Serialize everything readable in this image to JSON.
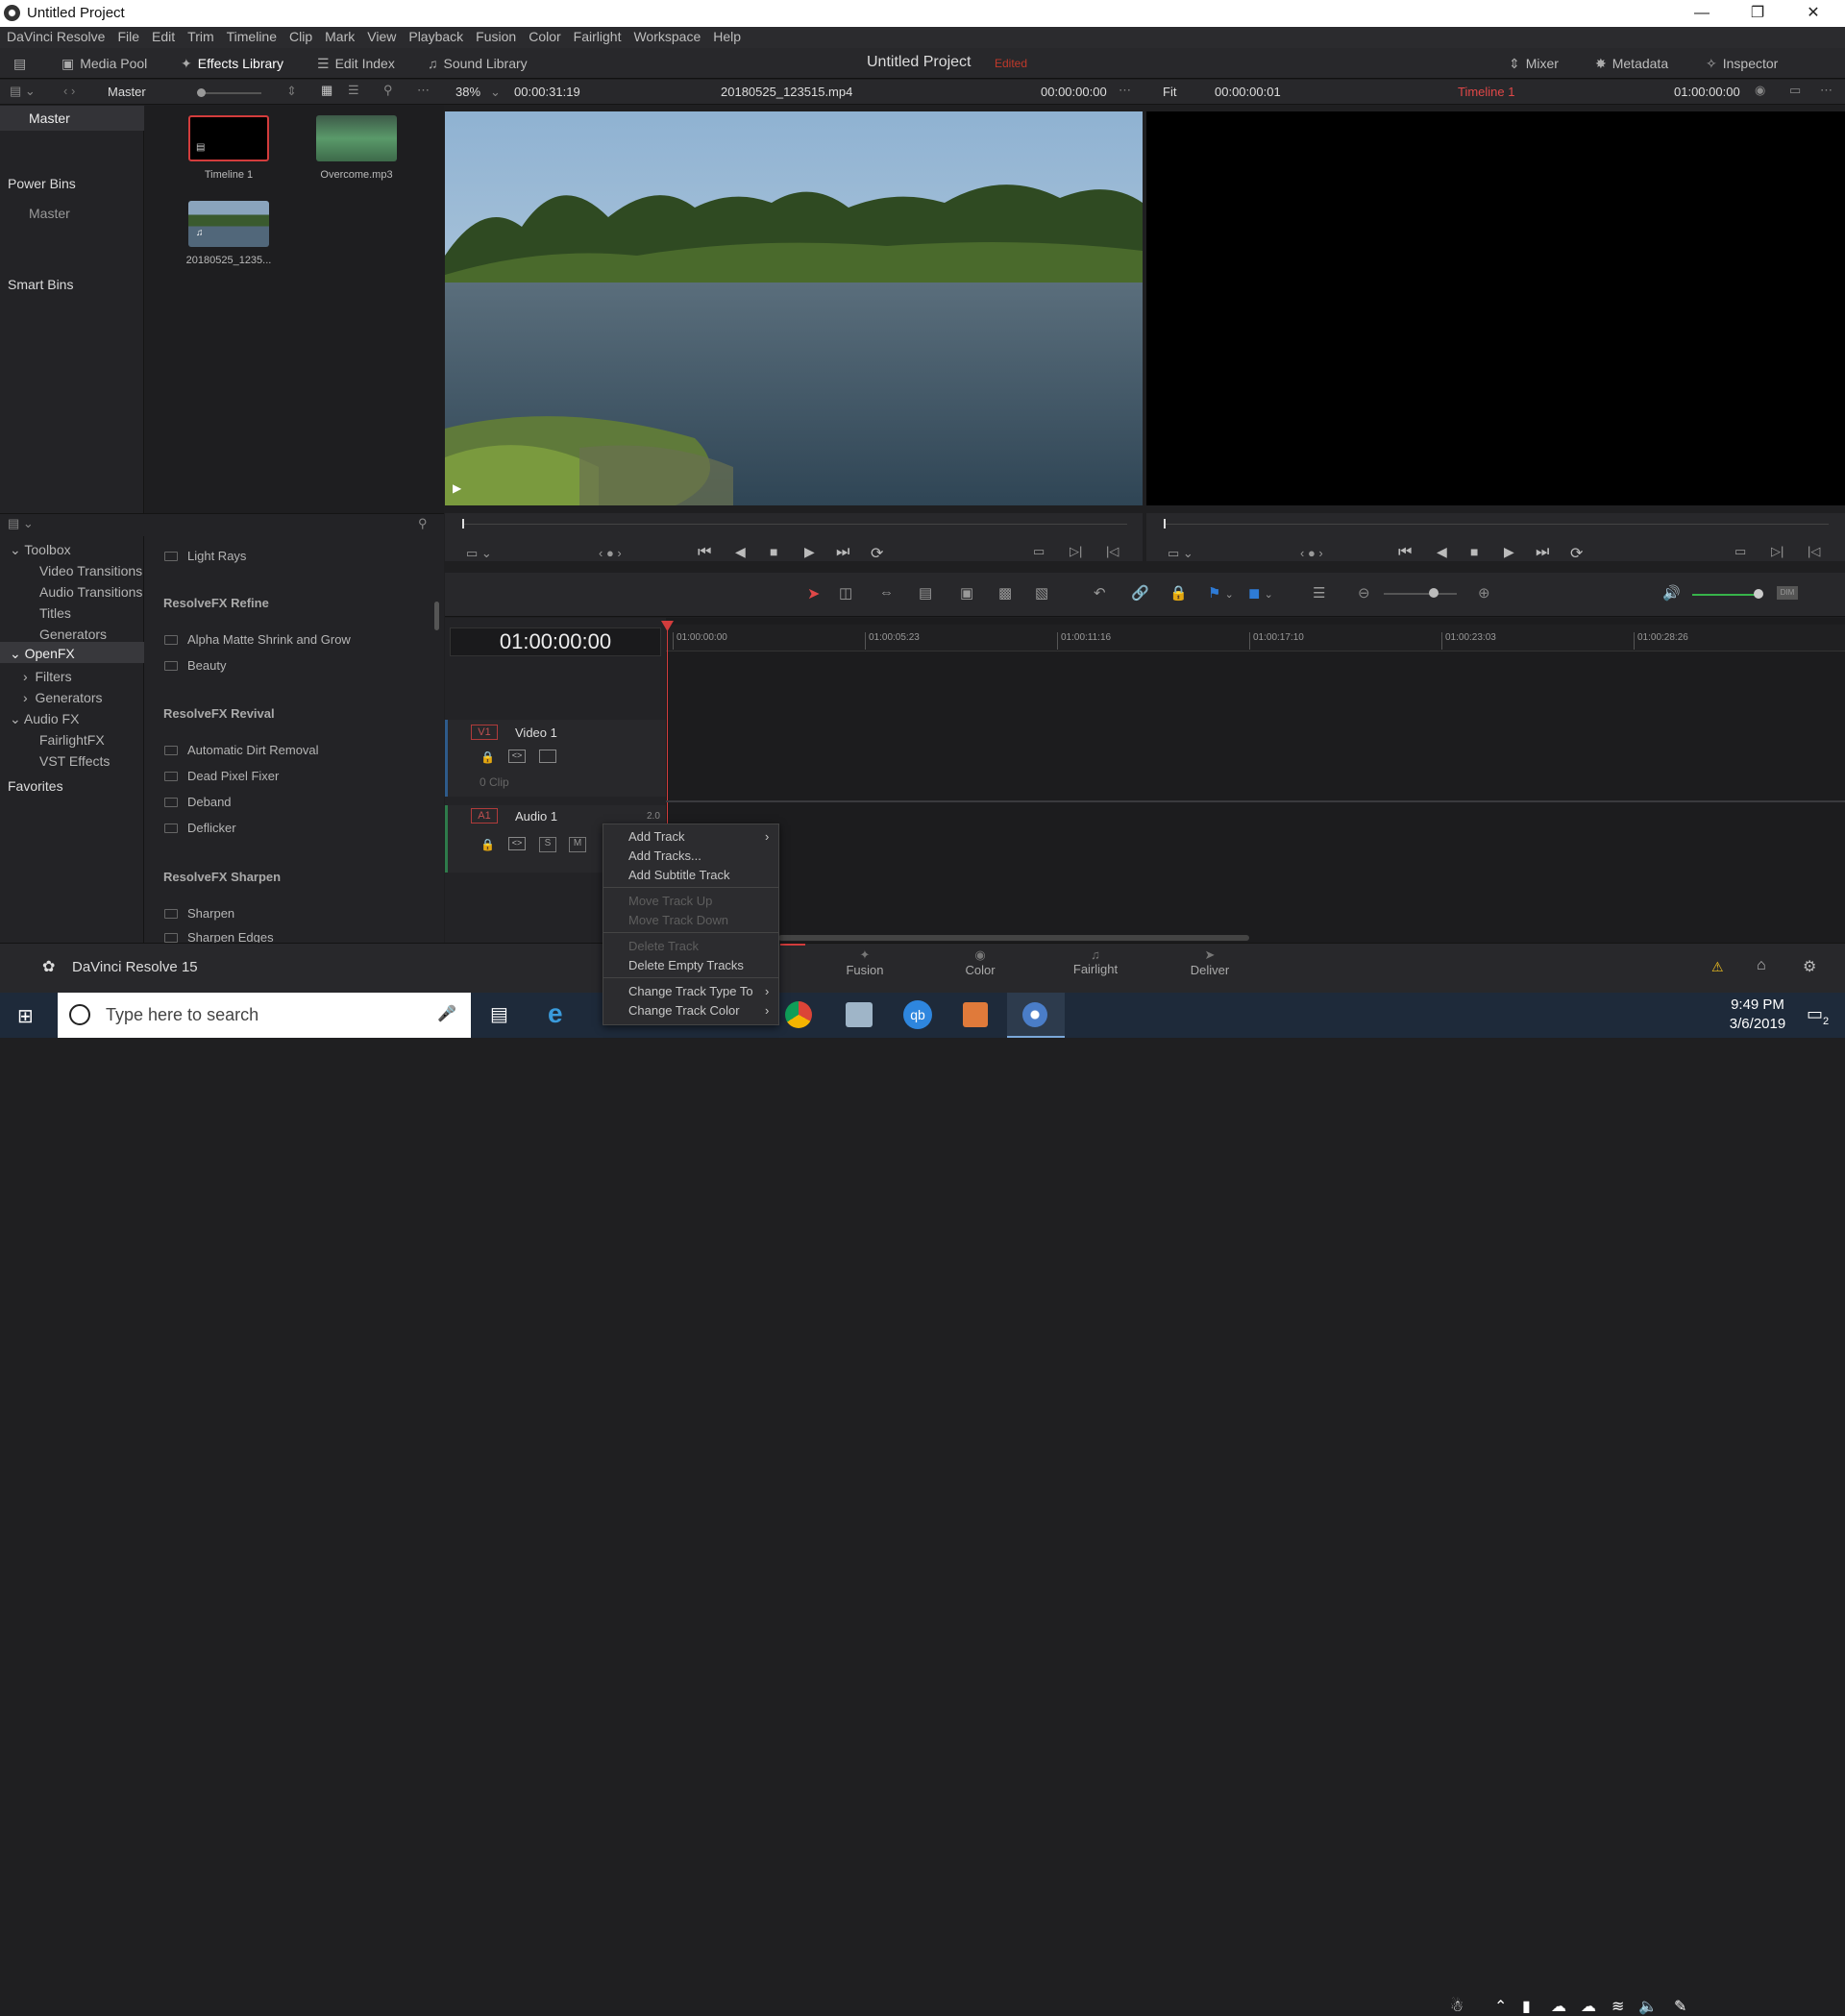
{
  "window": {
    "title": "Untitled Project"
  },
  "menu": [
    "DaVinci Resolve",
    "File",
    "Edit",
    "Trim",
    "Timeline",
    "Clip",
    "Mark",
    "View",
    "Playback",
    "Fusion",
    "Color",
    "Fairlight",
    "Workspace",
    "Help"
  ],
  "toolbar": {
    "media_pool": "Media Pool",
    "effects_library": "Effects Library",
    "edit_index": "Edit Index",
    "sound_library": "Sound Library",
    "project_title": "Untitled Project",
    "edited": "Edited",
    "mixer": "Mixer",
    "metadata": "Metadata",
    "inspector": "Inspector"
  },
  "subbar": {
    "bin": "Master",
    "zoom": "38%",
    "src_duration": "00:00:31:19",
    "clip_name": "20180525_123515.mp4",
    "src_tc": "00:00:00:00",
    "fit": "Fit",
    "prog_tc_a": "00:00:00:01",
    "timeline_name": "Timeline 1",
    "prog_tc_b": "01:00:00:00"
  },
  "bins": {
    "master": "Master",
    "power_bins": "Power Bins",
    "power_master": "Master",
    "smart_bins": "Smart Bins"
  },
  "clips": [
    {
      "name": "Timeline 1"
    },
    {
      "name": "Overcome.mp3"
    },
    {
      "name": "20180525_1235..."
    }
  ],
  "effects_tree": {
    "toolbox": "Toolbox",
    "video_transitions": "Video Transitions",
    "audio_transitions": "Audio Transitions",
    "titles": "Titles",
    "generators": "Generators",
    "openfx": "OpenFX",
    "filters": "Filters",
    "generators2": "Generators",
    "audio_fx": "Audio FX",
    "fairlightfx": "FairlightFX",
    "vst": "VST Effects",
    "favorites": "Favorites"
  },
  "fx": {
    "light_rays": "Light Rays",
    "refine": "ResolveFX Refine",
    "alpha": "Alpha Matte Shrink and Grow",
    "beauty": "Beauty",
    "revival": "ResolveFX Revival",
    "dirt": "Automatic Dirt Removal",
    "dead": "Dead Pixel Fixer",
    "deband": "Deband",
    "deflicker": "Deflicker",
    "sharpen_head": "ResolveFX Sharpen",
    "sharpen": "Sharpen",
    "sharpen_edges": "Sharpen Edges"
  },
  "timeline": {
    "tc": "01:00:00:00",
    "ticks": [
      "01:00:00:00",
      "01:00:05:23",
      "01:00:11:16",
      "01:00:17:10",
      "01:00:23:03",
      "01:00:28:26"
    ],
    "v1": "V1",
    "video1": "Video 1",
    "clips": "0 Clip",
    "a1": "A1",
    "audio1": "Audio 1",
    "audio_ch": "2.0"
  },
  "context_menu": {
    "add_track": "Add Track",
    "add_tracks": "Add Tracks...",
    "add_subtitle": "Add Subtitle Track",
    "move_up": "Move Track Up",
    "move_down": "Move Track Down",
    "delete_track": "Delete Track",
    "delete_empty": "Delete Empty Tracks",
    "change_type": "Change Track Type To",
    "change_color": "Change Track Color"
  },
  "pages": {
    "fusion": "Fusion",
    "color": "Color",
    "fairlight": "Fairlight",
    "deliver": "Deliver"
  },
  "app_name": "DaVinci Resolve 15",
  "taskbar": {
    "search": "Type here to search",
    "time": "9:49 PM",
    "date": "3/6/2019",
    "notif": "2"
  }
}
